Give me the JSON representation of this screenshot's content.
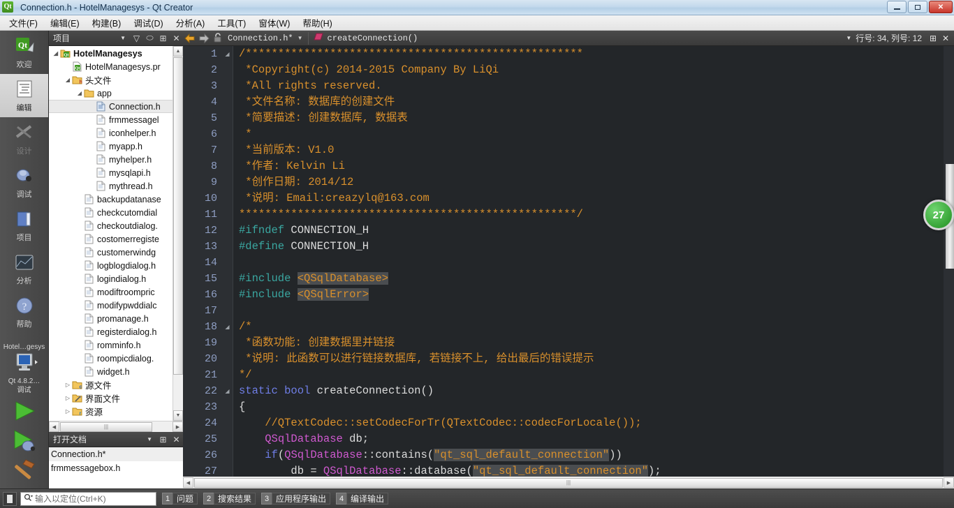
{
  "window": {
    "title": "Connection.h - HotelManagesys - Qt Creator",
    "app_icon": "qt-logo-icon",
    "minimize_label": "Minimize",
    "restore_label": "Restore",
    "close_label": "Close"
  },
  "menubar": {
    "items": [
      {
        "label": "文件(F)",
        "name": "menu-file"
      },
      {
        "label": "编辑(E)",
        "name": "menu-edit"
      },
      {
        "label": "构建(B)",
        "name": "menu-build"
      },
      {
        "label": "调试(D)",
        "name": "menu-debug"
      },
      {
        "label": "分析(A)",
        "name": "menu-analyze"
      },
      {
        "label": "工具(T)",
        "name": "menu-tools"
      },
      {
        "label": "窗体(W)",
        "name": "menu-window"
      },
      {
        "label": "帮助(H)",
        "name": "menu-help"
      }
    ]
  },
  "modebar": {
    "modes": [
      {
        "label": "欢迎",
        "icon": "qt-welcome-icon",
        "state": "normal"
      },
      {
        "label": "编辑",
        "icon": "edit-document-icon",
        "state": "active"
      },
      {
        "label": "设计",
        "icon": "design-brush-icon",
        "state": "disabled"
      },
      {
        "label": "调试",
        "icon": "debug-bug-icon",
        "state": "normal"
      },
      {
        "label": "项目",
        "icon": "projects-folder-icon",
        "state": "normal"
      },
      {
        "label": "分析",
        "icon": "analyze-chart-icon",
        "state": "normal"
      },
      {
        "label": "帮助",
        "icon": "help-question-icon",
        "state": "normal"
      }
    ],
    "kit": {
      "project": "Hotel…gesys",
      "icon": "target-monitor-icon",
      "kit_line1": "Qt 4.8.2…",
      "kit_line2": "调试"
    },
    "actions": [
      {
        "name": "run-button",
        "icon": "run-play-icon"
      },
      {
        "name": "debug-button",
        "icon": "debug-play-icon"
      },
      {
        "name": "build-button",
        "icon": "build-hammer-icon"
      }
    ]
  },
  "leftdock": {
    "project_panel": {
      "combo_value": "项目",
      "toolbar_icons": [
        {
          "name": "filter-icon",
          "glyph": "▽"
        },
        {
          "name": "link-sync-icon",
          "glyph": "⬭"
        },
        {
          "name": "split-add-icon",
          "glyph": "⊞"
        },
        {
          "name": "close-panel-icon",
          "glyph": "✕"
        }
      ],
      "tree": [
        {
          "indent": 0,
          "arrow": "expanded",
          "icon": "qt-project-icon",
          "label": "HotelManagesys",
          "bold": true
        },
        {
          "indent": 1,
          "arrow": "none",
          "icon": "qt-pro-file-icon",
          "label": "HotelManagesys.pr",
          "bold": false
        },
        {
          "indent": 1,
          "arrow": "expanded",
          "icon": "headers-folder-icon",
          "label": "头文件",
          "bold": false
        },
        {
          "indent": 2,
          "arrow": "expanded",
          "icon": "folder-icon",
          "label": "app",
          "bold": false
        },
        {
          "indent": 3,
          "arrow": "none",
          "icon": "header-file-icon",
          "label": "Connection.h",
          "bold": false,
          "selected": true
        },
        {
          "indent": 3,
          "arrow": "none",
          "icon": "header-file-icon",
          "label": "frmmessagel",
          "bold": false
        },
        {
          "indent": 3,
          "arrow": "none",
          "icon": "header-file-icon",
          "label": "iconhelper.h",
          "bold": false
        },
        {
          "indent": 3,
          "arrow": "none",
          "icon": "header-file-icon",
          "label": "myapp.h",
          "bold": false
        },
        {
          "indent": 3,
          "arrow": "none",
          "icon": "header-file-icon",
          "label": "myhelper.h",
          "bold": false
        },
        {
          "indent": 3,
          "arrow": "none",
          "icon": "header-file-icon",
          "label": "mysqlapi.h",
          "bold": false
        },
        {
          "indent": 3,
          "arrow": "none",
          "icon": "header-file-icon",
          "label": "mythread.h",
          "bold": false
        },
        {
          "indent": 2,
          "arrow": "none",
          "icon": "header-file-icon",
          "label": "backupdatanase",
          "bold": false
        },
        {
          "indent": 2,
          "arrow": "none",
          "icon": "header-file-icon",
          "label": "checkcutomdial",
          "bold": false
        },
        {
          "indent": 2,
          "arrow": "none",
          "icon": "header-file-icon",
          "label": "checkoutdialog.",
          "bold": false
        },
        {
          "indent": 2,
          "arrow": "none",
          "icon": "header-file-icon",
          "label": "costomerregiste",
          "bold": false
        },
        {
          "indent": 2,
          "arrow": "none",
          "icon": "header-file-icon",
          "label": "customerwindg",
          "bold": false
        },
        {
          "indent": 2,
          "arrow": "none",
          "icon": "header-file-icon",
          "label": "logblogdialog.h",
          "bold": false
        },
        {
          "indent": 2,
          "arrow": "none",
          "icon": "header-file-icon",
          "label": "logindialog.h",
          "bold": false
        },
        {
          "indent": 2,
          "arrow": "none",
          "icon": "header-file-icon",
          "label": "modiftroompric",
          "bold": false
        },
        {
          "indent": 2,
          "arrow": "none",
          "icon": "header-file-icon",
          "label": "modifypwddialc",
          "bold": false
        },
        {
          "indent": 2,
          "arrow": "none",
          "icon": "header-file-icon",
          "label": "promanage.h",
          "bold": false
        },
        {
          "indent": 2,
          "arrow": "none",
          "icon": "header-file-icon",
          "label": "registerdialog.h",
          "bold": false
        },
        {
          "indent": 2,
          "arrow": "none",
          "icon": "header-file-icon",
          "label": "romminfo.h",
          "bold": false
        },
        {
          "indent": 2,
          "arrow": "none",
          "icon": "header-file-icon",
          "label": "roompicdialog.",
          "bold": false
        },
        {
          "indent": 2,
          "arrow": "none",
          "icon": "header-file-icon",
          "label": "widget.h",
          "bold": false
        },
        {
          "indent": 1,
          "arrow": "collapsed",
          "icon": "sources-folder-icon",
          "label": "源文件",
          "bold": false
        },
        {
          "indent": 1,
          "arrow": "collapsed",
          "icon": "forms-folder-icon",
          "label": "界面文件",
          "bold": false
        },
        {
          "indent": 1,
          "arrow": "collapsed",
          "icon": "resources-folder-icon",
          "label": "资源",
          "bold": false
        }
      ]
    },
    "open_documents": {
      "combo_value": "打开文档",
      "toolbar_icons": [
        {
          "name": "split-add-icon",
          "glyph": "⊞"
        },
        {
          "name": "close-panel-icon",
          "glyph": "✕"
        }
      ],
      "items": [
        {
          "label": "Connection.h*",
          "selected": true
        },
        {
          "label": "frmmessagebox.h",
          "selected": false
        }
      ]
    }
  },
  "editor": {
    "toolbar": {
      "back_icon": "nav-back-icon",
      "forward_icon": "nav-forward-icon",
      "lock_icon": "unlocked-icon",
      "file_combo": "Connection.h*",
      "symbol_icon": "method-pink-icon",
      "symbol_combo": "createConnection()",
      "line_col_label": "行号: 34, 列号: 12",
      "split_icon": "split-add-icon",
      "close_icon": "close-editor-icon"
    },
    "first_line": 1,
    "lines": [
      {
        "n": 1,
        "fold": "start",
        "tokens": [
          {
            "t": "/****************************************************",
            "c": "com"
          }
        ]
      },
      {
        "n": 2,
        "fold": "",
        "tokens": [
          {
            "t": " *Copyright(c) 2014-2015 Company By LiQi",
            "c": "com"
          }
        ]
      },
      {
        "n": 3,
        "fold": "",
        "tokens": [
          {
            "t": " *All rights reserved.",
            "c": "com"
          }
        ]
      },
      {
        "n": 4,
        "fold": "",
        "tokens": [
          {
            "t": " *文件名称: 数据库的创建文件",
            "c": "com"
          }
        ]
      },
      {
        "n": 5,
        "fold": "",
        "tokens": [
          {
            "t": " *简要描述: 创建数据库, 数据表",
            "c": "com"
          }
        ]
      },
      {
        "n": 6,
        "fold": "",
        "tokens": [
          {
            "t": " *",
            "c": "com"
          }
        ]
      },
      {
        "n": 7,
        "fold": "",
        "tokens": [
          {
            "t": " *当前版本: V1.0",
            "c": "com"
          }
        ]
      },
      {
        "n": 8,
        "fold": "",
        "tokens": [
          {
            "t": " *作者: Kelvin Li",
            "c": "com"
          }
        ]
      },
      {
        "n": 9,
        "fold": "",
        "tokens": [
          {
            "t": " *创作日期: 2014/12",
            "c": "com"
          }
        ]
      },
      {
        "n": 10,
        "fold": "",
        "tokens": [
          {
            "t": " *说明: Email:creazylq@163.com",
            "c": "com"
          }
        ]
      },
      {
        "n": 11,
        "fold": "",
        "tokens": [
          {
            "t": "****************************************************/",
            "c": "com"
          }
        ]
      },
      {
        "n": 12,
        "fold": "",
        "tokens": [
          {
            "t": "#ifndef",
            "c": "pre"
          },
          {
            "t": " CONNECTION_H",
            "c": "plain"
          }
        ]
      },
      {
        "n": 13,
        "fold": "",
        "tokens": [
          {
            "t": "#define",
            "c": "pre"
          },
          {
            "t": " CONNECTION_H",
            "c": "plain"
          }
        ]
      },
      {
        "n": 14,
        "fold": "",
        "tokens": [
          {
            "t": "",
            "c": "plain"
          }
        ]
      },
      {
        "n": 15,
        "fold": "",
        "tokens": [
          {
            "t": "#include",
            "c": "pre"
          },
          {
            "t": " ",
            "c": "plain"
          },
          {
            "t": "<QSqlDatabase>",
            "c": "str",
            "hl": true
          }
        ]
      },
      {
        "n": 16,
        "fold": "",
        "tokens": [
          {
            "t": "#include",
            "c": "pre"
          },
          {
            "t": " ",
            "c": "plain"
          },
          {
            "t": "<QSqlError>",
            "c": "str",
            "hl": true
          }
        ]
      },
      {
        "n": 17,
        "fold": "",
        "tokens": [
          {
            "t": "",
            "c": "plain"
          }
        ]
      },
      {
        "n": 18,
        "fold": "start",
        "tokens": [
          {
            "t": "/*",
            "c": "com"
          }
        ]
      },
      {
        "n": 19,
        "fold": "",
        "tokens": [
          {
            "t": " *函数功能: 创建数据里并链接",
            "c": "com"
          }
        ]
      },
      {
        "n": 20,
        "fold": "",
        "tokens": [
          {
            "t": " *说明: 此函数可以进行链接数据库, 若链接不上, 给出最后的错误提示",
            "c": "com"
          }
        ]
      },
      {
        "n": 21,
        "fold": "",
        "tokens": [
          {
            "t": "*/",
            "c": "com"
          }
        ]
      },
      {
        "n": 22,
        "fold": "start",
        "tokens": [
          {
            "t": "static bool",
            "c": "key"
          },
          {
            "t": " createConnection()",
            "c": "plain"
          }
        ]
      },
      {
        "n": 23,
        "fold": "",
        "tokens": [
          {
            "t": "{",
            "c": "plain"
          }
        ]
      },
      {
        "n": 24,
        "fold": "",
        "tokens": [
          {
            "t": "    //QTextCodec::setCodecForTr(QTextCodec::codecForLocale());",
            "c": "com"
          }
        ]
      },
      {
        "n": 25,
        "fold": "",
        "tokens": [
          {
            "t": "    ",
            "c": "plain"
          },
          {
            "t": "QSqlDatabase",
            "c": "typ"
          },
          {
            "t": " db;",
            "c": "plain"
          }
        ]
      },
      {
        "n": 26,
        "fold": "",
        "tokens": [
          {
            "t": "    ",
            "c": "plain"
          },
          {
            "t": "if",
            "c": "key"
          },
          {
            "t": "(",
            "c": "plain"
          },
          {
            "t": "QSqlDatabase",
            "c": "typ"
          },
          {
            "t": "::contains(",
            "c": "plain"
          },
          {
            "t": "\"qt_sql_default_connection\"",
            "c": "str",
            "hl": true
          },
          {
            "t": "))",
            "c": "plain"
          }
        ]
      },
      {
        "n": 27,
        "fold": "",
        "tokens": [
          {
            "t": "        db = ",
            "c": "plain"
          },
          {
            "t": "QSqlDatabase",
            "c": "typ"
          },
          {
            "t": "::database(",
            "c": "plain"
          },
          {
            "t": "\"qt_sql_default_connection\"",
            "c": "str",
            "hl": true
          },
          {
            "t": ");",
            "c": "plain"
          }
        ]
      }
    ]
  },
  "statusbar": {
    "sidebar_toggle_icon": "toggle-sidebar-icon",
    "locator": {
      "icon": "search-icon",
      "placeholder": "输入以定位(Ctrl+K)",
      "value": ""
    },
    "output_panes": [
      {
        "num": "1",
        "label": "问题"
      },
      {
        "num": "2",
        "label": "搜索结果"
      },
      {
        "num": "3",
        "label": "应用程序输出"
      },
      {
        "num": "4",
        "label": "编译输出"
      }
    ]
  },
  "progress_badge": {
    "value": "27"
  },
  "colors": {
    "editor_bg": "#232629",
    "gutter_bg": "#2c2f33",
    "comment": "#d9902c",
    "preprocessor": "#3aa6a0",
    "keyword": "#6f7ee6",
    "type": "#cf59cf",
    "string": "#d9902c",
    "linenum": "#8f9fc4",
    "chrome": "#3a3a3a"
  }
}
